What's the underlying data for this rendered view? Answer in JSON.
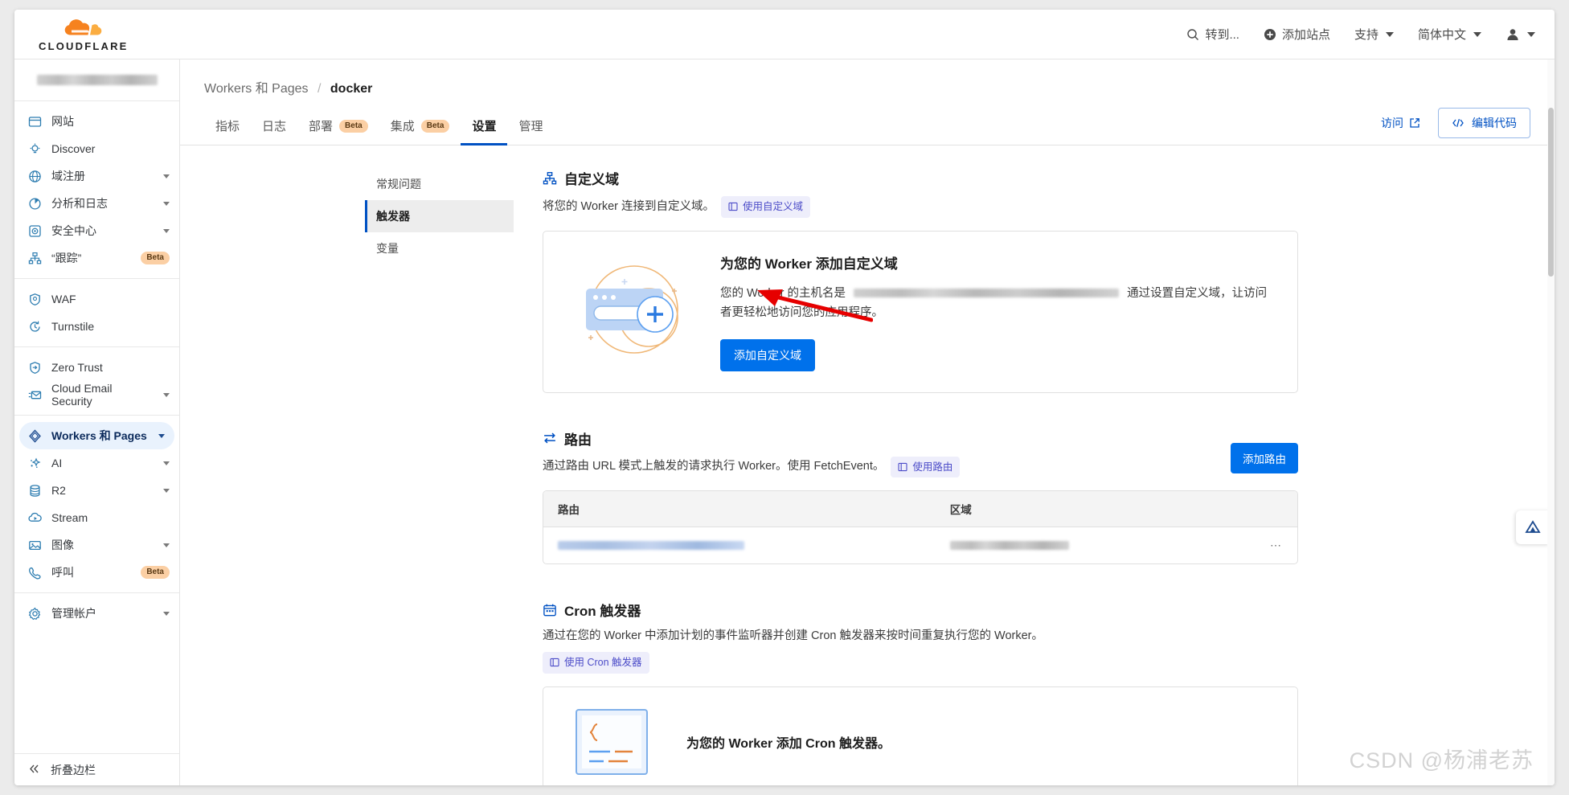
{
  "brand": {
    "name": "CLOUDFLARE",
    "logo_icon": "cloudflare-logo-icon",
    "accent": "#f6821f"
  },
  "topnav": {
    "search": {
      "label": "转到...",
      "icon": "search-icon"
    },
    "add_site": {
      "label": "添加站点",
      "icon": "plus-circle-icon"
    },
    "support": {
      "label": "支持",
      "icon": "chevron-down-icon"
    },
    "language": {
      "label": "简体中文",
      "icon": "chevron-down-icon"
    },
    "account": {
      "label": "",
      "icon": "user-avatar-icon"
    }
  },
  "sidebar": {
    "account_name_redacted": true,
    "groups": [
      {
        "items": [
          {
            "label": "网站",
            "icon": "browser-window-icon",
            "expandable": false,
            "active": false
          },
          {
            "label": "Discover",
            "icon": "lightbulb-icon",
            "expandable": false,
            "active": false
          },
          {
            "label": "域注册",
            "icon": "globe-icon",
            "expandable": true,
            "active": false
          },
          {
            "label": "分析和日志",
            "icon": "pie-chart-icon",
            "expandable": true,
            "active": false
          },
          {
            "label": "安全中心",
            "icon": "shield-target-icon",
            "expandable": true,
            "active": false
          },
          {
            "label": "“跟踪”",
            "icon": "sitemap-icon",
            "badge": "Beta",
            "expandable": false,
            "active": false
          }
        ]
      },
      {
        "items": [
          {
            "label": "WAF",
            "icon": "shield-waf-icon",
            "expandable": false,
            "active": false
          },
          {
            "label": "Turnstile",
            "icon": "turnstile-icon",
            "expandable": false,
            "active": false
          }
        ]
      },
      {
        "items": [
          {
            "label": "Zero Trust",
            "icon": "zero-trust-icon",
            "expandable": false,
            "active": false
          },
          {
            "label": "Cloud Email Security",
            "icon": "envelope-icon",
            "expandable": true,
            "active": false
          }
        ]
      },
      {
        "items": [
          {
            "label": "Workers 和 Pages",
            "icon": "workers-icon",
            "expandable": true,
            "active": true
          },
          {
            "label": "AI",
            "icon": "sparkle-ai-icon",
            "expandable": true,
            "active": false
          },
          {
            "label": "R2",
            "icon": "database-icon",
            "expandable": true,
            "active": false
          },
          {
            "label": "Stream",
            "icon": "stream-cloud-play-icon",
            "expandable": false,
            "active": false
          },
          {
            "label": "图像",
            "icon": "image-icon",
            "expandable": true,
            "active": false
          },
          {
            "label": "呼叫",
            "icon": "phone-icon",
            "badge": "Beta",
            "expandable": false,
            "active": false
          }
        ]
      },
      {
        "items": [
          {
            "label": "管理帐户",
            "icon": "gear-icon",
            "expandable": true,
            "active": false
          }
        ]
      }
    ],
    "collapse": {
      "label": "折叠边栏",
      "icon": "double-chevron-left-icon"
    }
  },
  "breadcrumb": {
    "parent": "Workers 和 Pages",
    "separator": "/",
    "current": "docker"
  },
  "tabs": [
    {
      "label": "指标",
      "badge": "",
      "active": false
    },
    {
      "label": "日志",
      "badge": "",
      "active": false
    },
    {
      "label": "部署",
      "badge": "Beta",
      "active": false
    },
    {
      "label": "集成",
      "badge": "Beta",
      "active": false
    },
    {
      "label": "设置",
      "badge": "",
      "active": true
    },
    {
      "label": "管理",
      "badge": "",
      "active": false
    }
  ],
  "tab_actions": {
    "visit": {
      "label": "访问",
      "icon": "external-link-icon"
    },
    "edit_code": {
      "label": "编辑代码",
      "icon": "code-brackets-icon"
    }
  },
  "subnav": [
    {
      "label": "常规问题",
      "active": false
    },
    {
      "label": "触发器",
      "active": true
    },
    {
      "label": "变量",
      "active": false
    }
  ],
  "sections": {
    "custom_domain": {
      "icon": "sitemap-icon",
      "title": "自定义域",
      "desc": "将您的 Worker 连接到自定义域。",
      "doc_chip": {
        "label": "使用自定义域",
        "icon": "book-icon"
      },
      "card": {
        "heading": "为您的 Worker 添加自定义域",
        "body_prefix": "您的 Worker 的主机名是",
        "body_suffix": "通过设置自定义域，让访问者更轻松地访问您的应用程序。",
        "hostname_redacted": true,
        "button": "添加自定义域",
        "art_icon": "add-domain-illustration"
      }
    },
    "routes": {
      "icon": "route-arrows-icon",
      "title": "路由",
      "desc": "通过路由 URL 模式上触发的请求执行 Worker。使用 FetchEvent。",
      "doc_chip": {
        "label": "使用路由",
        "icon": "book-icon"
      },
      "add_button": "添加路由",
      "table": {
        "columns": [
          "路由",
          "区域"
        ],
        "rows": [
          {
            "route_redacted": true,
            "zone_redacted": true,
            "menu_icon": "ellipsis-icon"
          }
        ]
      }
    },
    "cron": {
      "icon": "calendar-icon",
      "title": "Cron 触发器",
      "desc": "通过在您的 Worker 中添加计划的事件监听器并创建 Cron 触发器来按时间重复执行您的 Worker。",
      "doc_chip": {
        "label": "使用 Cron 触发器",
        "icon": "book-icon"
      },
      "card": {
        "heading": "为您的 Worker 添加 Cron 触发器。",
        "art_icon": "cron-code-illustration"
      }
    }
  },
  "annotation": {
    "arrow_icon": "red-arrow-pointing-left",
    "color": "#e60000"
  },
  "watermark": {
    "text": "CSDN @杨浦老苏"
  },
  "help_fab": {
    "icon": "cloudflare-help-icon"
  }
}
